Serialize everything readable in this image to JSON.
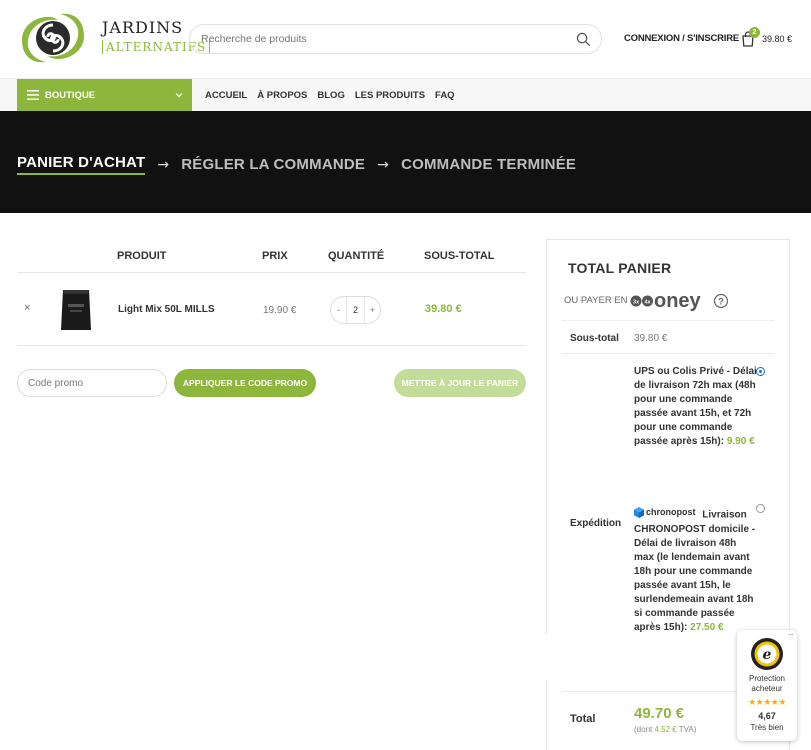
{
  "header": {
    "logo_line1": "JARDINS",
    "logo_line2": "ALTERNATIFS",
    "search_placeholder": "Recherche de produits",
    "login_label": "CONNEXION / S'INSCRIRE",
    "cart_count": "2",
    "cart_total": "39.80 €"
  },
  "nav": {
    "shop_label": "BOUTIQUE",
    "links": [
      "ACCUEIL",
      "À PROPOS",
      "BLOG",
      "LES PRODUITS",
      "FAQ"
    ]
  },
  "steps": {
    "cart": "PANIER D'ACHAT",
    "checkout": "RÉGLER LA COMMANDE",
    "complete": "COMMANDE TERMINÉE",
    "arrow": "→"
  },
  "cart": {
    "columns": [
      "PRODUIT",
      "PRIX",
      "QUANTITÉ",
      "SOUS-TOTAL"
    ],
    "items": [
      {
        "remove": "×",
        "name": "Light Mix 50L MILLS",
        "price": "19.90 €",
        "qty": "2",
        "subtotal": "39.80 €"
      }
    ],
    "qty_minus": "-",
    "qty_plus": "+",
    "promo_placeholder": "Code promo",
    "apply_label": "APPLIQUER LE CODE PROMO",
    "update_label": "METTRE À JOUR LE PANIER"
  },
  "totals": {
    "title": "TOTAL PANIER",
    "pay_with": "OU PAYER EN",
    "oney_brand": "oney",
    "subtotal_label": "Sous-total",
    "subtotal_value": "39.80 €",
    "shipping_label": "Expédition",
    "ship1_text": "UPS ou Colis Privé - Délai de livraison 72h max (48h pour une commande passée avant 15h, et 72h pour une commande passée après 15h):",
    "ship1_price": "9.90 €",
    "chrono_brand": "chronopost",
    "ship2_text": "Livraison CHRONOPOST domicile - Délai de livraison 48h max (le lendemain avant 18h pour une commande passée avant 15h, le surlendemeain avant 18h si commande passée après 15h):",
    "ship2_price": "27.50 €",
    "total_label": "Total",
    "total_value": "49.70 €",
    "tva_prefix": "(dont",
    "tva_value": "4.52 €",
    "tva_suffix": "TVA)"
  },
  "trust_badge": {
    "protection": "Protection acheteur",
    "stars": "★★★★★",
    "score": "4,67",
    "rating_label": "Très bien",
    "menu": "···"
  },
  "colors": {
    "accent": "#8cb63c",
    "banner": "#111111",
    "radio_selected": "#1a6ed8"
  }
}
